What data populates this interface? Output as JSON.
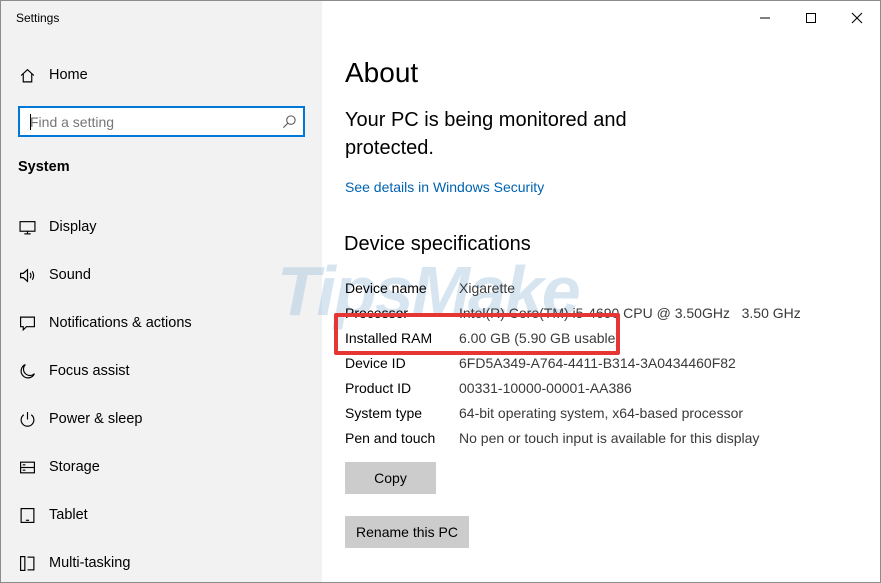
{
  "window": {
    "title": "Settings"
  },
  "sidebar": {
    "home_label": "Home",
    "search": {
      "placeholder": "Find a setting",
      "value": ""
    },
    "section_heading": "System",
    "items": [
      {
        "label": "Display",
        "icon": "display-icon"
      },
      {
        "label": "Sound",
        "icon": "speaker-icon"
      },
      {
        "label": "Notifications & actions",
        "icon": "notification-icon"
      },
      {
        "label": "Focus assist",
        "icon": "moon-icon"
      },
      {
        "label": "Power & sleep",
        "icon": "power-icon"
      },
      {
        "label": "Storage",
        "icon": "storage-icon"
      },
      {
        "label": "Tablet",
        "icon": "tablet-icon"
      },
      {
        "label": "Multi-tasking",
        "icon": "multitask-icon"
      }
    ]
  },
  "main": {
    "title": "About",
    "protection_text": "Your PC is being monitored and protected.",
    "security_link": "See details in Windows Security",
    "device_specs_heading": "Device specifications",
    "specs": [
      {
        "key": "Device name",
        "value": "Xigarette"
      },
      {
        "key": "Processor",
        "value": "Intel(R) Core(TM) i5-4690 CPU @ 3.50GHz   3.50 GHz"
      },
      {
        "key": "Installed RAM",
        "value": "6.00 GB (5.90 GB usable)"
      },
      {
        "key": "Device ID",
        "value": "6FD5A349-A764-4411-B314-3A0434460F82"
      },
      {
        "key": "Product ID",
        "value": "00331-10000-00001-AA386"
      },
      {
        "key": "System type",
        "value": "64-bit operating system, x64-based processor"
      },
      {
        "key": "Pen and touch",
        "value": "No pen or touch input is available for this display"
      }
    ],
    "copy_button": "Copy",
    "rename_button": "Rename this PC"
  },
  "watermark": "TipsMake",
  "colors": {
    "accent": "#0078d7",
    "link": "#0063b1",
    "highlight": "#e53535",
    "sidebar_bg": "#f2f2f2",
    "button_bg": "#cccccc"
  }
}
